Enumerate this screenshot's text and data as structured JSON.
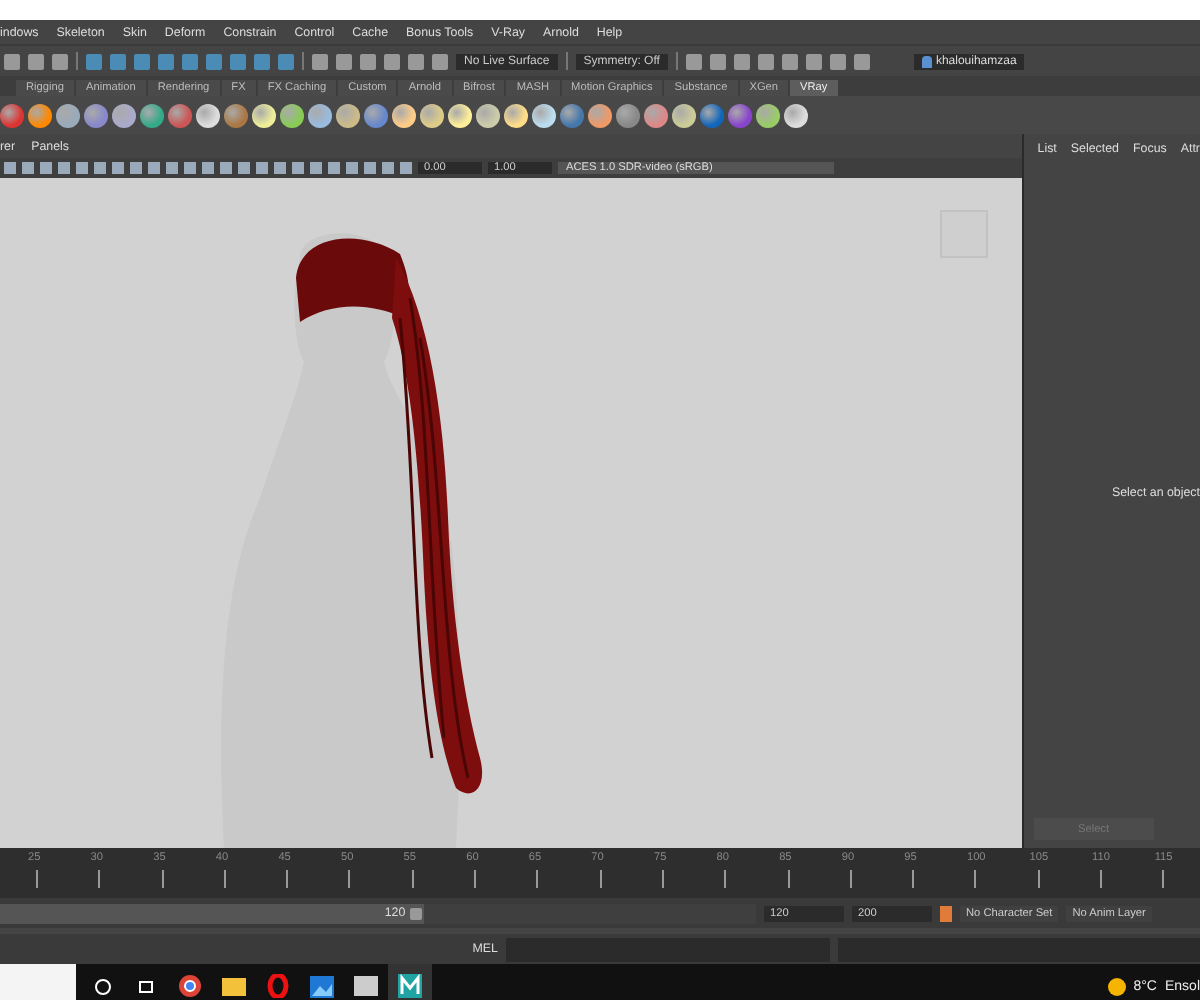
{
  "menu_bar": [
    "indows",
    "Skeleton",
    "Skin",
    "Deform",
    "Constrain",
    "Control",
    "Cache",
    "Bonus Tools",
    "V-Ray",
    "Arnold",
    "Help"
  ],
  "status_line": {
    "live_surface": "No Live Surface",
    "symmetry": "Symmetry: Off",
    "account": "khalouihamzaa"
  },
  "shelf_tabs": [
    {
      "label": "Rigging",
      "selected": false
    },
    {
      "label": "Animation",
      "selected": false
    },
    {
      "label": "Rendering",
      "selected": false
    },
    {
      "label": "FX",
      "selected": false
    },
    {
      "label": "FX Caching",
      "selected": false
    },
    {
      "label": "Custom",
      "selected": false
    },
    {
      "label": "Arnold",
      "selected": false
    },
    {
      "label": "Bifrost",
      "selected": false
    },
    {
      "label": "MASH",
      "selected": false
    },
    {
      "label": "Motion Graphics",
      "selected": false
    },
    {
      "label": "Substance",
      "selected": false
    },
    {
      "label": "XGen",
      "selected": false
    },
    {
      "label": "VRay",
      "selected": true
    }
  ],
  "viewport": {
    "menus": [
      "rer",
      "Panels"
    ],
    "exposure": "0.00",
    "gamma": "1.00",
    "color_space": "ACES 1.0 SDR-video (sRGB)"
  },
  "side_panel": {
    "tabs": [
      "List",
      "Selected",
      "Focus",
      "Attr"
    ],
    "message": "Select an object",
    "button": "Select"
  },
  "timeline": {
    "ticks": [
      "25",
      "30",
      "35",
      "40",
      "45",
      "50",
      "55",
      "60",
      "65",
      "70",
      "75",
      "80",
      "85",
      "90",
      "95",
      "100",
      "105",
      "110",
      "115"
    ]
  },
  "range": {
    "level": 0.56,
    "slider_end": "120",
    "end_field": "120",
    "max_field": "200",
    "character_set": "No Character Set",
    "anim_layer": "No Anim Layer"
  },
  "command_line": {
    "language": "MEL"
  },
  "taskbar": {
    "temperature": "8°C",
    "weather": "Ensol"
  }
}
